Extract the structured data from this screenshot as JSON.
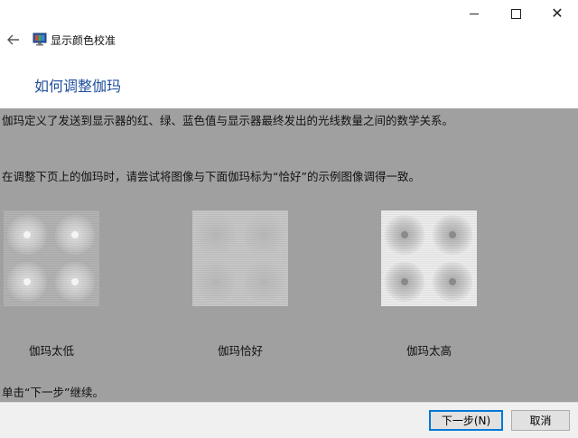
{
  "window": {
    "app_title": "显示颜色校准",
    "minimize_label": "",
    "maximize_label": "",
    "close_label": "✕"
  },
  "header": {
    "page_title": "如何调整伽玛"
  },
  "content": {
    "paragraph1": "伽玛定义了发送到显示器的红、绿、蓝色值与显示器最终发出的光线数量之间的数学关系。",
    "paragraph2": "在调整下页上的伽玛时，请尝试将图像与下面伽玛标为“恰好”的示例图像调得一致。",
    "samples": [
      {
        "caption": "伽玛太低",
        "base": "#b4b4b4",
        "dot": "#f4f4f4"
      },
      {
        "caption": "伽玛恰好",
        "base": "#c8c8c8",
        "dot": "#b6b6b6"
      },
      {
        "caption": "伽玛太高",
        "base": "#eeeeee",
        "dot": "#8a8a8a"
      }
    ],
    "paragraph3": "单击“下一步”继续。"
  },
  "footer": {
    "next_label": "下一步(N)",
    "cancel_label": "取消"
  },
  "colors": {
    "title_blue": "#1f4e9c",
    "dim_background": "#a0a0a0"
  }
}
